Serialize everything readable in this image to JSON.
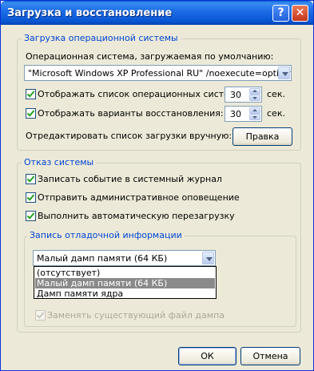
{
  "window": {
    "title": "Загрузка и восстановление",
    "help_glyph": "?",
    "close_glyph": "✕"
  },
  "startup": {
    "legend": "Загрузка операционной системы",
    "default_os_label": "Операционная система, загружаемая по умолчанию:",
    "default_os_value": "\"Microsoft Windows XP Professional RU\" /noexecute=optin /fastd",
    "show_os_list": {
      "label": "Отображать список операционных систем:",
      "checked": true,
      "value": "30",
      "unit": "сек."
    },
    "show_recovery": {
      "label": "Отображать варианты восстановления:",
      "checked": true,
      "value": "30",
      "unit": "сек."
    },
    "edit_label": "Отредактировать список загрузки вручную:",
    "edit_button": "Правка"
  },
  "failure": {
    "legend": "Отказ системы",
    "options": [
      {
        "label": "Записать событие в системный журнал",
        "checked": true
      },
      {
        "label": "Отправить административное оповещение",
        "checked": true
      },
      {
        "label": "Выполнить автоматическую перезагрузку",
        "checked": true
      }
    ]
  },
  "debug": {
    "legend": "Запись отладочной информации",
    "selected": "Малый дамп памяти (64 КБ)",
    "list": [
      "(отсутствует)",
      "Малый дамп памяти (64 КБ)",
      "Дамп памяти ядра"
    ],
    "overwrite_label": "Заменять существующий файл дампа",
    "overwrite_checked": true
  },
  "buttons": {
    "ok": "ОК",
    "cancel": "Отмена"
  }
}
